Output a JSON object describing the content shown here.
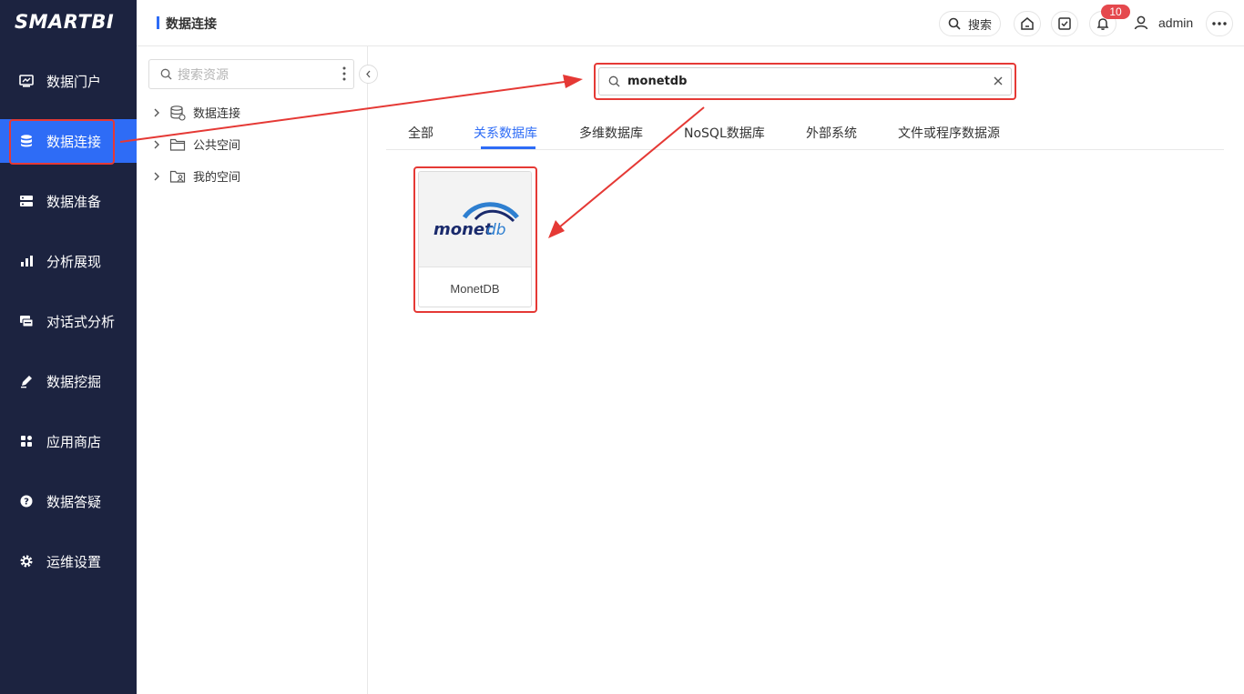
{
  "app": {
    "logo": "SMARTBI"
  },
  "sidebar": {
    "items": [
      {
        "label": "数据门户",
        "icon": "monitor-icon"
      },
      {
        "label": "数据连接",
        "icon": "database-icon",
        "active": true
      },
      {
        "label": "数据准备",
        "icon": "server-icon"
      },
      {
        "label": "分析展现",
        "icon": "bar-chart-icon"
      },
      {
        "label": "对话式分析",
        "icon": "chat-icon"
      },
      {
        "label": "数据挖掘",
        "icon": "pen-icon"
      },
      {
        "label": "应用商店",
        "icon": "apps-icon"
      },
      {
        "label": "数据答疑",
        "icon": "question-icon"
      },
      {
        "label": "运维设置",
        "icon": "gear-icon"
      }
    ]
  },
  "header": {
    "title": "数据连接",
    "search_label": "搜索",
    "notification_count": "10",
    "username": "admin"
  },
  "resources": {
    "search_placeholder": "搜索资源",
    "tree": [
      {
        "label": "数据连接",
        "icon": "database-folder-icon"
      },
      {
        "label": "公共空间",
        "icon": "folder-icon"
      },
      {
        "label": "我的空间",
        "icon": "user-folder-icon"
      }
    ]
  },
  "main": {
    "search_value": "monetdb",
    "tabs": [
      {
        "label": "全部"
      },
      {
        "label": "关系数据库",
        "active": true
      },
      {
        "label": "多维数据库"
      },
      {
        "label": "NoSQL数据库"
      },
      {
        "label": "外部系统"
      },
      {
        "label": "文件或程序数据源"
      }
    ],
    "cards": [
      {
        "label": "MonetDB",
        "logo_text_1": "monet",
        "logo_text_2": "db"
      }
    ]
  },
  "colors": {
    "sidebar_bg": "#1c2340",
    "accent": "#2e6cf6",
    "annotation": "#e53935",
    "badge": "#e5484d"
  }
}
